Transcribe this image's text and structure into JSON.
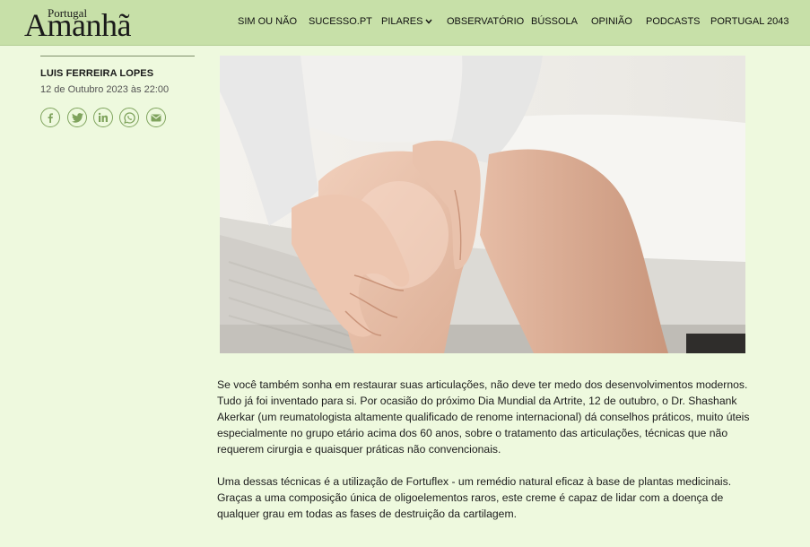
{
  "header": {
    "logo_small": "Portugal",
    "logo_big": "Amanhã",
    "nav": [
      {
        "label": "SIM OU NÃO"
      },
      {
        "label": "SUCESSO.PT"
      },
      {
        "label": "PILARES"
      },
      {
        "label": "OBSERVATÓRIO"
      },
      {
        "label": "BÚSSOLA"
      },
      {
        "label": "OPINIÃO"
      },
      {
        "label": "PODCASTS"
      },
      {
        "label": "PORTUGAL 2043"
      }
    ]
  },
  "author": {
    "name": "LUIS FERREIRA LOPES",
    "date": "12 de Outubro 2023 às 22:00"
  },
  "share": {
    "icons": [
      "facebook-icon",
      "twitter-icon",
      "linkedin-icon",
      "whatsapp-icon",
      "email-icon"
    ]
  },
  "colors": {
    "page_bg": "#eef9de",
    "header_bg": "#c7e0a8",
    "share_icon": "#7fa35d"
  },
  "article": {
    "paragraphs": [
      "Se você também sonha em restaurar suas articulações, não deve ter medo dos desenvolvimentos modernos. Tudo já foi inventado para si. Por ocasião do próximo Dia Mundial da Artrite, 12 de outubro, o Dr. Shashank Akerkar (um reumatologista altamente qualificado de renome internacional) dá conselhos práticos, muito úteis especialmente no grupo etário acima dos 60 anos, sobre o tratamento das articulações, técnicas que não requerem cirurgia e quaisquer práticas não convencionais.",
      "Uma dessas técnicas é a utilização de Fortuflex - um remédio natural eficaz à base de plantas medicinais. Graças a uma composição única de oligoelementos raros, este creme é capaz de lidar com a doença de qualquer grau em todas as fases de destruição da cartilagem."
    ]
  }
}
